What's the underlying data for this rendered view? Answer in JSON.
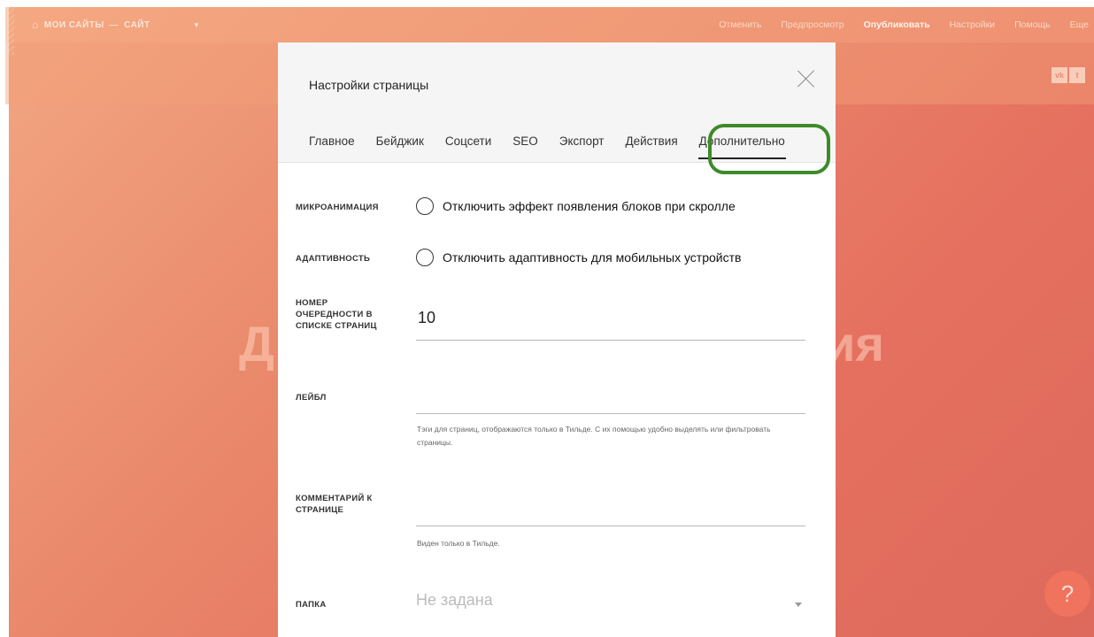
{
  "topbar": {
    "breadcrumb": {
      "root": "МОИ САЙТЫ",
      "separator": "—",
      "site": "САЙТ"
    },
    "menu": {
      "cancel": "Отменить",
      "preview": "Предпросмотр",
      "publish": "Опубликовать",
      "settings": "Настройки",
      "help": "Помощь",
      "more": "Еще"
    }
  },
  "social": {
    "vk": "vk",
    "twitter": "t"
  },
  "hero": {
    "left_fragment": "Д",
    "right_fragment": "ия"
  },
  "help_button": {
    "label": "?"
  },
  "modal": {
    "title": "Настройки страницы",
    "tabs": [
      "Главное",
      "Бейджик",
      "Соцсети",
      "SEO",
      "Экспорт",
      "Действия",
      "Дополнительно"
    ],
    "active_tab": "Дополнительно",
    "rows": {
      "microanimation": {
        "label": "МИКРОАНИМАЦИЯ",
        "option": "Отключить эффект появления блоков при скролле"
      },
      "adaptivity": {
        "label": "АДАПТИВНОСТЬ",
        "option": "Отключить адаптивность для мобильных устройств"
      },
      "order": {
        "label": "НОМЕР ОЧЕРЕДНОСТИ В СПИСКЕ СТРАНИЦ",
        "value": "10"
      },
      "label_field": {
        "label": "ЛЕЙБЛ",
        "value": "",
        "hint": "Тэги для страниц, отображаются только в Тильде. С их помощью удобно выделять или фильтровать страницы."
      },
      "comment": {
        "label": "КОММЕНТАРИЙ К СТРАНИЦЕ",
        "value": "",
        "hint": "Виден только в Тильде."
      },
      "folder": {
        "label": "ПАПКА",
        "placeholder": "Не задана"
      }
    }
  },
  "colors": {
    "accent_ring": "#3e8a2a",
    "background": "#e87c62",
    "help_button": "#f0735e"
  }
}
